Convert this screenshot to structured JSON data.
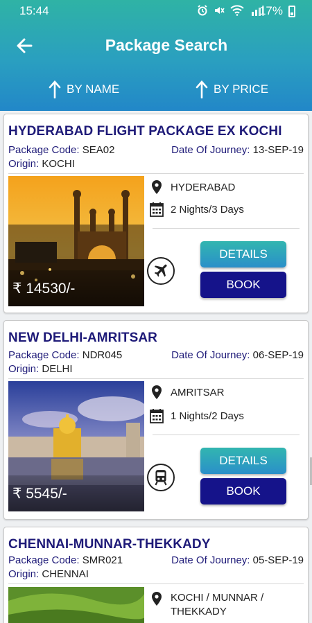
{
  "status_bar": {
    "time": "15:44",
    "battery_percent": "17%",
    "icons": [
      "alarm-icon",
      "mute-icon",
      "wifi-icon",
      "signal-icon",
      "battery-icon"
    ]
  },
  "header": {
    "title": "Package Search",
    "back_icon": "arrow-left-icon"
  },
  "sort": {
    "by_name": "BY NAME",
    "by_price": "BY PRICE"
  },
  "labels": {
    "package_code": "Package Code:",
    "date_of_journey": "Date Of Journey:",
    "origin": "Origin:",
    "details": "DETAILS",
    "book": "BOOK"
  },
  "colors": {
    "header_gradient_top": "#2fb3a5",
    "header_gradient_bottom": "#2287c8",
    "title_navy": "#1e1a78",
    "book_button": "#15138a",
    "details_button_top": "#32b6b0",
    "details_button_bottom": "#2a8fc9"
  },
  "packages": [
    {
      "title": "HYDERABAD FLIGHT PACKAGE EX KOCHI",
      "code": "SEA02",
      "date": "13-SEP-19",
      "origin": "KOCHI",
      "destination": "HYDERABAD",
      "duration": "2 Nights/3 Days",
      "price": "₹ 14530/-",
      "mode_icon": "airplane-icon"
    },
    {
      "title": "NEW DELHI-AMRITSAR",
      "code": "NDR045",
      "date": "06-SEP-19",
      "origin": "DELHI",
      "destination": "AMRITSAR",
      "duration": "1 Nights/2 Days",
      "price": "₹ 5545/-",
      "mode_icon": "train-icon"
    },
    {
      "title": "CHENNAI-MUNNAR-THEKKADY",
      "code": "SMR021",
      "date": "05-SEP-19",
      "origin": "CHENNAI",
      "destination": "KOCHI / MUNNAR / THEKKADY"
    }
  ]
}
